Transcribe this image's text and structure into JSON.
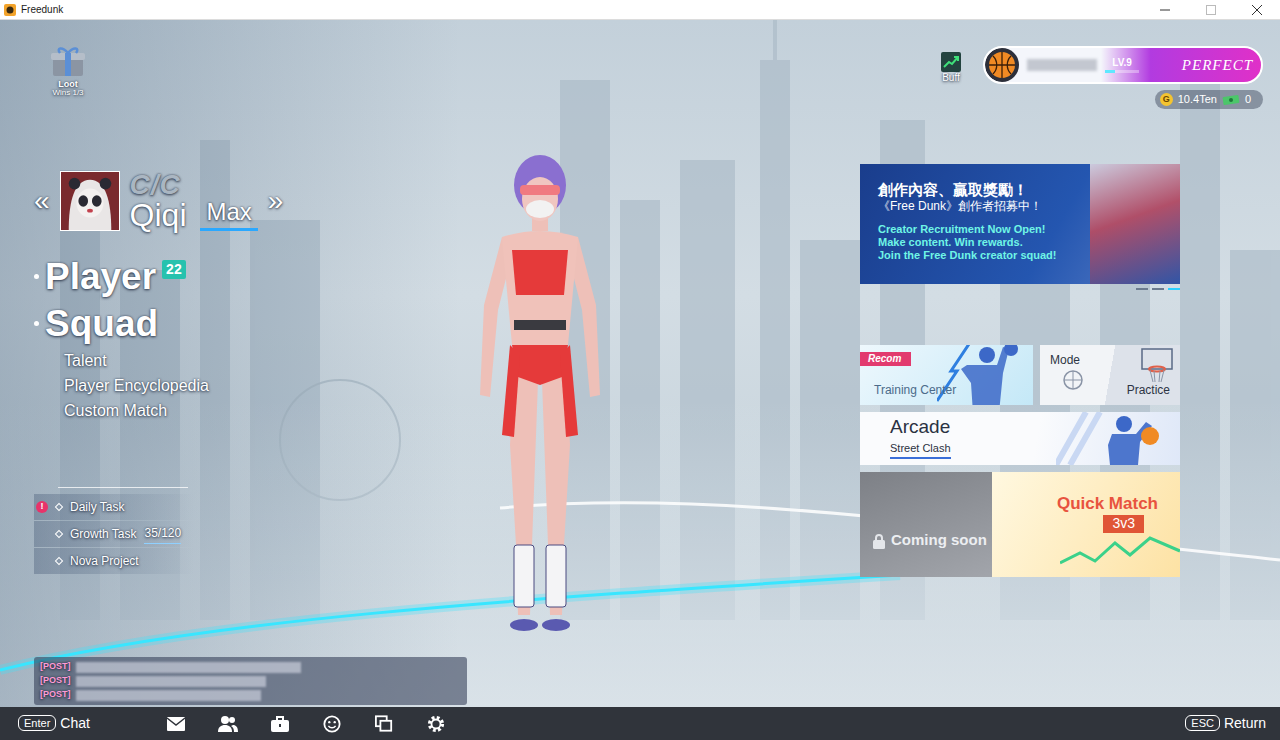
{
  "window": {
    "title": "Freedunk"
  },
  "loot": {
    "label": "Loot",
    "progress": "Wins 1/3"
  },
  "character": {
    "prev": "«",
    "grade": "C/C",
    "name": "Qiqi",
    "tier": "Max",
    "next": "»"
  },
  "menu": [
    {
      "label": "Player",
      "kind": "major",
      "badge": "22"
    },
    {
      "label": "Squad",
      "kind": "major"
    },
    {
      "label": "Talent",
      "kind": "minor"
    },
    {
      "label": "Player Encyclopedia",
      "kind": "minor"
    },
    {
      "label": "Custom Match",
      "kind": "minor"
    }
  ],
  "tasks": [
    {
      "label": "Daily Task",
      "alert": "!"
    },
    {
      "label": "Growth Task",
      "count": "35/120"
    },
    {
      "label": "Nova Project"
    }
  ],
  "chat": {
    "lines": [
      {
        "tag": "[POST]",
        "redacted": true
      },
      {
        "tag": "[POST]",
        "redacted": true
      },
      {
        "tag": "[POST]",
        "redacted": true
      }
    ]
  },
  "hud": {
    "buff": "Buff",
    "name_redacted": true,
    "lv_label": "LV.9",
    "exp_bar": {
      "level": 0.3
    },
    "rank": "PERFECT"
  },
  "currency": [
    {
      "kind": "gold",
      "icon_text": "G",
      "amount": "10.4Ten"
    },
    {
      "kind": "cash",
      "amount": "0"
    }
  ],
  "banner": {
    "headline": "創作內容、贏取獎勵！",
    "subline": "《Free Dunk》創作者招募中！",
    "lines": [
      "Creator Recruitment Now Open!",
      "Make content. Win rewards.",
      "Join the Free Dunk creator squad!"
    ],
    "slides": [
      {
        "selected": false
      },
      {
        "selected": false
      },
      {
        "selected": true
      }
    ]
  },
  "modes": [
    {
      "kind": "training",
      "tag": "Recom",
      "title": "Training Center"
    },
    {
      "kind": "practice",
      "top": "Mode",
      "bottom": "Practice"
    },
    {
      "kind": "arcade",
      "title": "Arcade",
      "subtitle": "Street Clash"
    },
    {
      "kind": "locked",
      "title": "Coming soon",
      "locked": true
    },
    {
      "kind": "quick",
      "title": "Quick Match",
      "subtitle": "3v3"
    }
  ],
  "bottom_bar": {
    "chat_key": "Enter",
    "chat_label": "Chat",
    "return_key": "ESC",
    "return_label": "Return"
  }
}
